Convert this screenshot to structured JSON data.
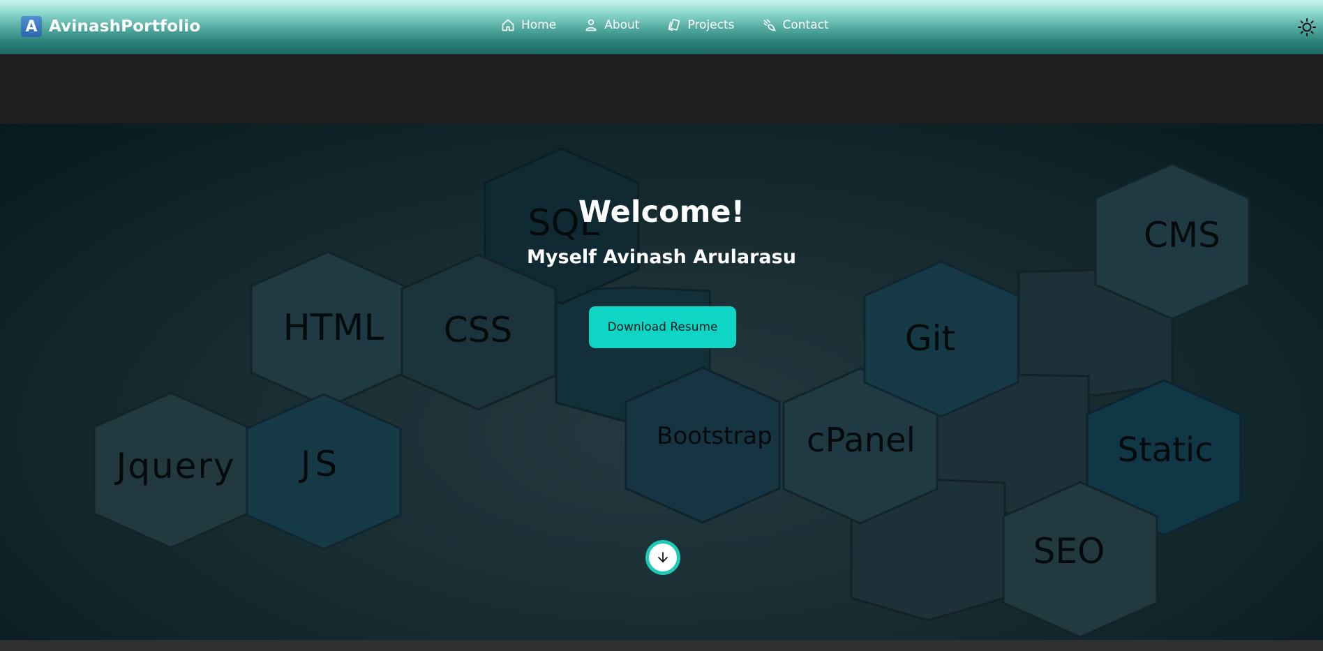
{
  "brand": {
    "logo_letter": "A",
    "name": "AvinashPortfolio"
  },
  "nav": {
    "items": [
      {
        "label": "Home",
        "icon": "home-icon"
      },
      {
        "label": "About",
        "icon": "user-icon"
      },
      {
        "label": "Projects",
        "icon": "projects-icon"
      },
      {
        "label": "Contact",
        "icon": "contact-icon"
      }
    ],
    "theme_toggle_icon": "sun-icon"
  },
  "hero": {
    "title": "Welcome!",
    "subtitle": "Myself Avinash Arularasu",
    "button_label": "Download Resume",
    "scroll_icon": "arrow-down-icon",
    "skills": [
      "SQL",
      "HTML",
      "CSS",
      "Jquery",
      "JS",
      "Bootstrap",
      "cPanel",
      "Git",
      "CMS",
      "Static",
      "SEO"
    ]
  },
  "colors": {
    "accent": "#0fd6c4",
    "navbar_top": "#c9f7ef",
    "navbar_bottom": "#1f6a65",
    "hero_bg": "#0f2529"
  }
}
